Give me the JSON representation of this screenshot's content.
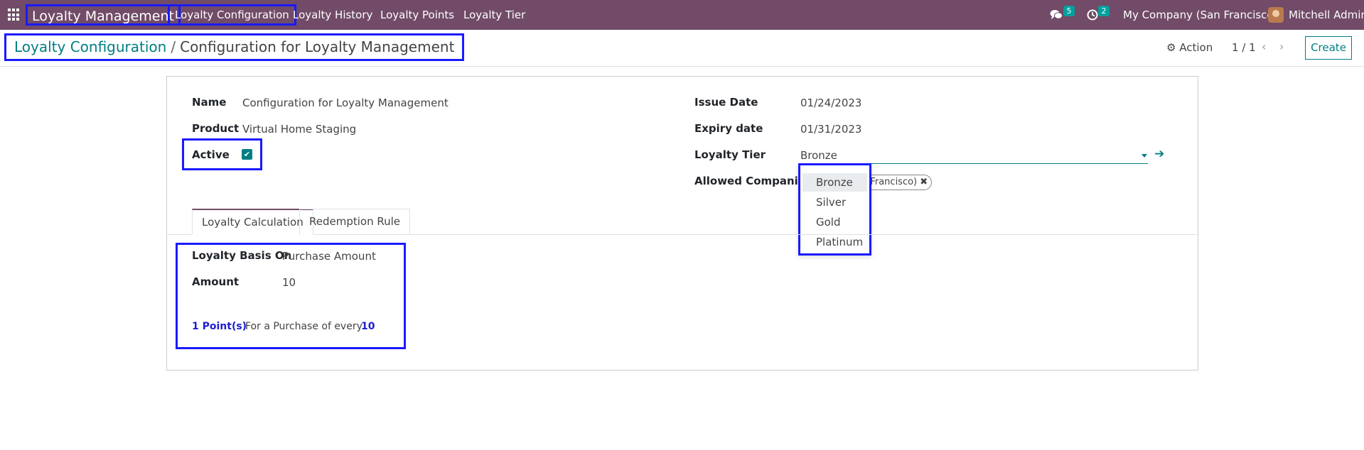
{
  "navbar": {
    "brand": "Loyalty Management",
    "menu": [
      "Loyalty Configuration",
      "Loyalty History",
      "Loyalty Points",
      "Loyalty Tier"
    ],
    "messages_count": "5",
    "activities_count": "2",
    "company": "My Company (San Francisco)",
    "user": "Mitchell Admin"
  },
  "control_panel": {
    "breadcrumb_parent": "Loyalty Configuration",
    "breadcrumb_separator": "/",
    "breadcrumb_current": "Configuration for Loyalty Management",
    "action_label": "Action",
    "pager": "1 / 1",
    "create_label": "Create"
  },
  "form": {
    "name_label": "Name",
    "name_value": "Configuration for Loyalty Management",
    "product_label": "Product",
    "product_value": "Virtual Home Staging",
    "active_label": "Active",
    "active_checked": true,
    "issue_date_label": "Issue Date",
    "issue_date_value": "01/24/2023",
    "expiry_date_label": "Expiry date",
    "expiry_date_value": "01/31/2023",
    "loyalty_tier_label": "Loyalty Tier",
    "loyalty_tier_value": "Bronze",
    "allowed_companies_label": "Allowed Companies",
    "allowed_company_tag": "an Francisco)",
    "tier_options": [
      "Bronze",
      "Silver",
      "Gold",
      "Platinum"
    ]
  },
  "tabs": [
    "Loyalty Calculation",
    "Redemption Rule"
  ],
  "loyalty_calculation": {
    "basis_label": "Loyalty Basis On",
    "basis_value": "Purchase Amount",
    "amount_label": "Amount",
    "amount_value": "10",
    "points_text": "1 Point(s)",
    "for_purchase_text": "For a Purchase of every",
    "purchase_amount": "10"
  },
  "colors": {
    "navbar": "#714b67",
    "accent": "#017e84",
    "highlight_box": "#1a1aff"
  }
}
